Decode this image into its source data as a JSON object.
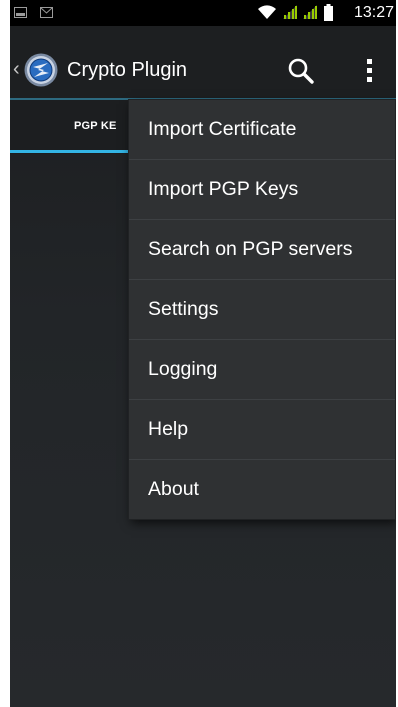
{
  "status_bar": {
    "time": "13:27",
    "icons": [
      "screenshot-notification-icon",
      "gmail-notification-icon",
      "wifi-icon",
      "signal-icon",
      "signal-icon",
      "battery-icon"
    ],
    "signal_color": "#99cc00"
  },
  "action_bar": {
    "title": "Crypto Plugin",
    "icons": [
      "back-icon",
      "app-logo",
      "search-icon",
      "overflow-menu-icon"
    ]
  },
  "tabs": [
    {
      "label": "PGP KE",
      "selected": true
    }
  ],
  "menu": {
    "items": [
      {
        "label": "Import Certificate"
      },
      {
        "label": "Import PGP Keys"
      },
      {
        "label": "Search on PGP servers"
      },
      {
        "label": "Settings"
      },
      {
        "label": "Logging"
      },
      {
        "label": "Help"
      },
      {
        "label": "About"
      }
    ]
  },
  "colors": {
    "accent": "#33b5e5",
    "background": "#222528",
    "menu_background": "#2f3133"
  }
}
